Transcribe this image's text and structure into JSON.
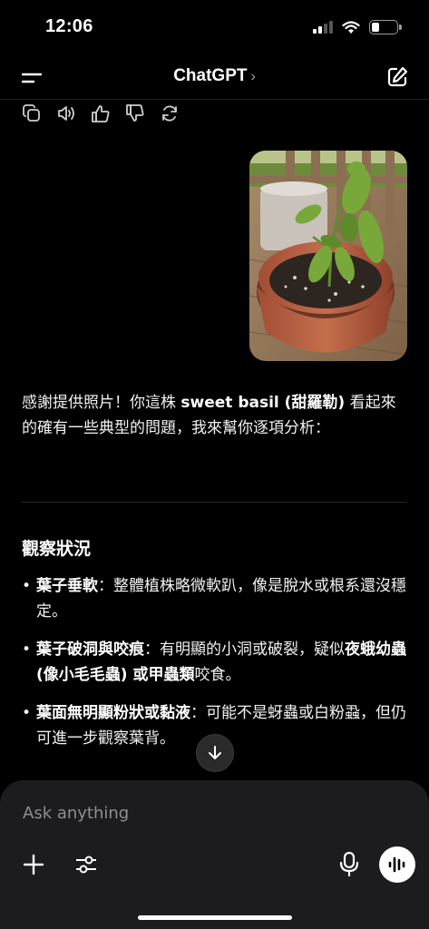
{
  "status": {
    "time": "12:06"
  },
  "nav": {
    "title": "ChatGPT",
    "chevron": "›"
  },
  "actions": {
    "icons": [
      "copy-icon",
      "speaker-icon",
      "thumbs-up-icon",
      "thumbs-down-icon",
      "regenerate-icon"
    ]
  },
  "message": {
    "intro_part1": "感謝提供照片！你這株 ",
    "intro_bold": "sweet basil (甜羅勒)",
    "intro_part2": " 看起來的確有一些典型的問題，我來幫你逐項分析：",
    "section_title": "觀察狀況",
    "bullets": [
      {
        "bold": "葉子垂軟",
        "text": "：整體植株略微軟趴，像是脫水或根系還沒穩定。"
      },
      {
        "bold_pre": "葉子破洞與咬痕",
        "text_pre": "：有明顯的小洞或破裂，疑似",
        "bold_mid": "夜蛾幼蟲 (像小毛毛蟲) 或甲蟲類",
        "text_post": "咬食。"
      },
      {
        "bold": "葉面無明顯粉狀或黏液",
        "text": "：可能不是蚜蟲或白粉蝨，但仍可進一步觀察葉背。"
      }
    ]
  },
  "composer": {
    "placeholder": "Ask anything"
  },
  "colors": {
    "background": "#000000",
    "composer": "#1c1c1e",
    "text": "#f2f2f2",
    "muted": "#8e8e93"
  }
}
